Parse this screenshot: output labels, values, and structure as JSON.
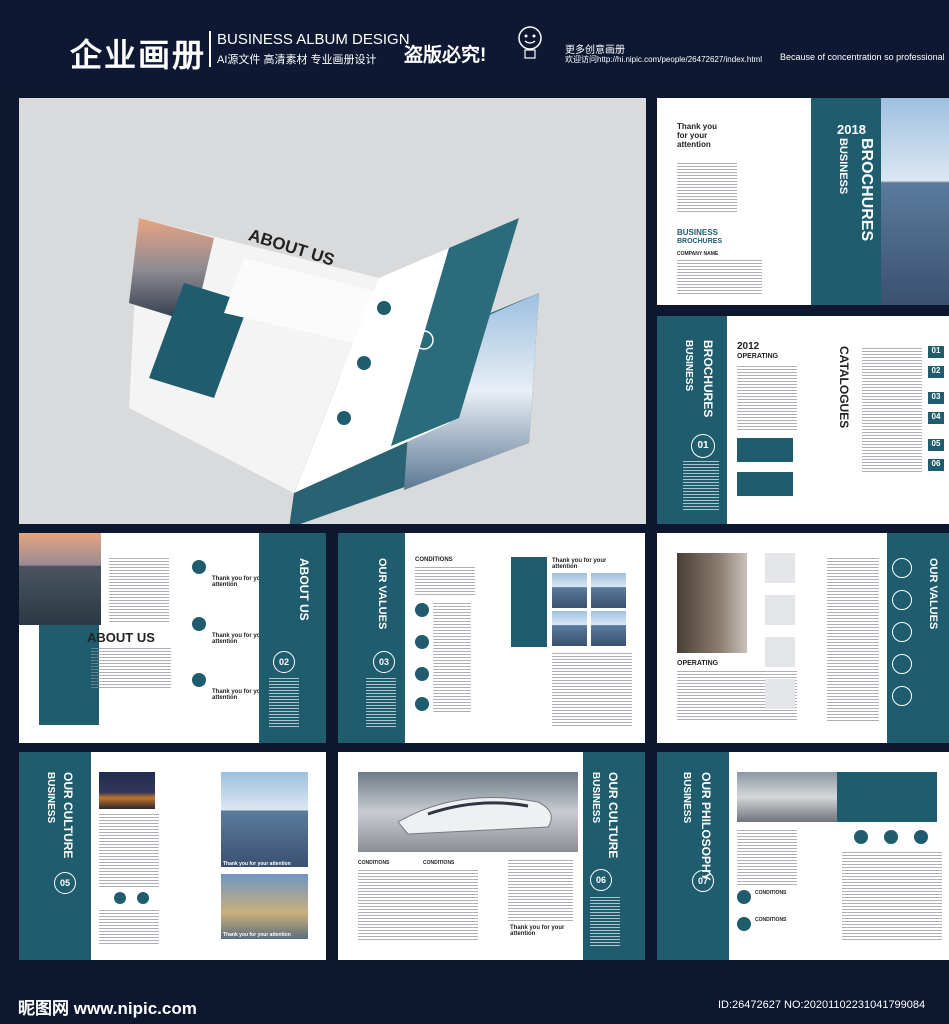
{
  "header": {
    "title": "企业画册",
    "subtitle_en": "BUSINESS ALBUM DESIGN",
    "subtitle_cn": "AI源文件 高清素材 专业画册设计",
    "warning": "盗版必究!",
    "more": "更多创意画册",
    "visit": "欢迎访问http://hi.nipic.com/people/26472627/index.html",
    "slogan": "Because of concentration so professional"
  },
  "brochure": {
    "about_us": "ABOUT US",
    "about_us_vertical": "ABOUT US",
    "thank_you": "Thank you for your attention",
    "thank_you_3line": "Thank you\nfor your\nattention",
    "num_02": "02",
    "num_01": "01",
    "num_03": "03",
    "num_05": "05",
    "num_06": "06",
    "num_07": "07",
    "year_2018": "2018",
    "brochures": "BROCHURES",
    "business": "BUSINESS",
    "company_name": "COMPANY NAME",
    "year_2012": "2012",
    "operating": "OPERATING",
    "catalogues": "CATALOGUES",
    "our_values": "OUR VALUES",
    "our_culture": "OUR CULTURE",
    "our_philosophy": "OUR PHILOSOPHY",
    "conditions": "CONDITIONS",
    "toc_nums": [
      "01",
      "02",
      "03",
      "04",
      "05",
      "06"
    ]
  },
  "footer": {
    "brand": "昵图网 www.nipic.com",
    "id": "ID:26472627 NO:20201102231041799084"
  },
  "colors": {
    "bg": "#0d1730",
    "teal": "#1f5c6d",
    "paper": "#ffffff"
  }
}
